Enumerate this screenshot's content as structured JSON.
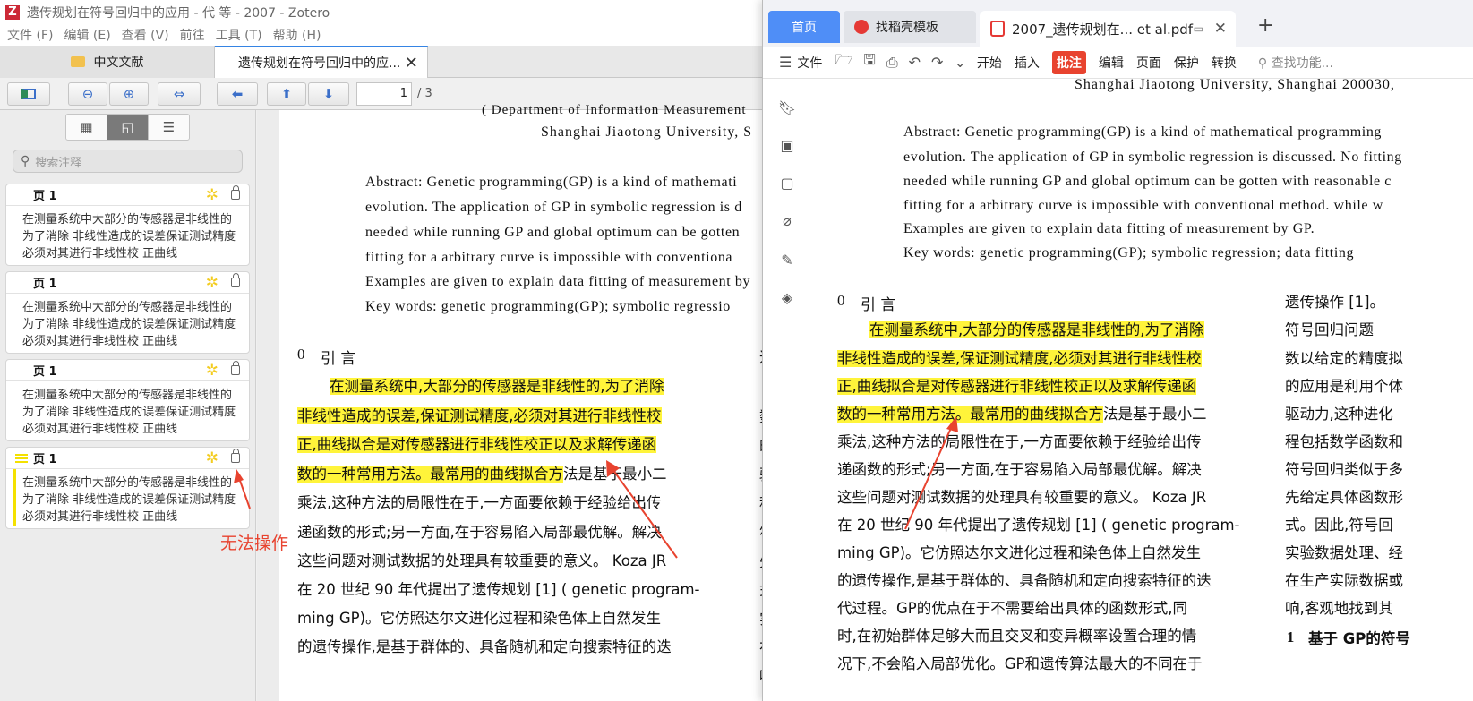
{
  "zotero": {
    "window_title": "遗传规划在符号回归中的应用 - 代 等 - 2007 - Zotero",
    "menu": [
      "文件 (F)",
      "编辑 (E)",
      "查看 (V)",
      "前往",
      "工具 (T)",
      "帮助 (H)"
    ],
    "tabs": [
      {
        "label": "中文文献"
      },
      {
        "label": "遗传规划在符号回归中的应..."
      }
    ],
    "toolbar": {
      "page_value": "1",
      "page_total": "/ 3"
    },
    "sidebar": {
      "search_placeholder": "搜索注释",
      "annotations": [
        {
          "page": "页 1",
          "text": "在测量系统中大部分的传感器是非线性的为了消除 非线性造成的误差保证测试精度必须对其进行非线性校 正曲线"
        },
        {
          "page": "页 1",
          "text": "在测量系统中大部分的传感器是非线性的为了消除 非线性造成的误差保证测试精度必须对其进行非线性校 正曲线"
        },
        {
          "page": "页 1",
          "text": "在测量系统中大部分的传感器是非线性的为了消除 非线性造成的误差保证测试精度必须对其进行非线性校 正曲线"
        },
        {
          "page": "页 1",
          "text": "在测量系统中大部分的传感器是非线性的为了消除 非线性造成的误差保证测试精度必须对其进行非线性校 正曲线"
        }
      ],
      "annotation_note": "无法操作"
    },
    "pdf": {
      "affil1": "( Department of Information Measurement",
      "affil2": "Shanghai Jiaotong University, S",
      "abstract_lines": [
        "Abstract:  Genetic programming(GP) is a kind of mathemati",
        "evolution. The application of GP  in  symbolic  regression  is  d",
        "needed while running GP and global optimum  can be gotten",
        "fitting for a arbitrary curve  is  impossible  with  conventiona",
        "Examples are given to explain data fitting of measurement by",
        "Key words:  genetic programming(GP);  symbolic regressio"
      ],
      "section_num": "0",
      "section_title": "引  言",
      "hl_lines": [
        "在测量系统中,大部分的传感器是非线性的,为了消除",
        "非线性造成的误差,保证测试精度,必须对其进行非线性校",
        "正,曲线拟合是对传感器进行非线性校正以及求解传递函",
        "数的一种常用方法。最常用的曲线拟合方"
      ],
      "hl_tail": "法是基于最小二",
      "body_lines": [
        "乘法,这种方法的局限性在于,一方面要依赖于经验给出传",
        "递函数的形式;另一方面,在于容易陷入局部最优解。解决",
        "这些问题对测试数据的处理具有较重要的意义。 Koza JR",
        "在  20 世纪   90 年代提出了遗传规划 [1] ( genetic program-",
        "ming GP)。它仿照达尔文进化过程和染色体上自然发生",
        "的遗传操作,是基于群体的、具备随机和定向搜索特征的迭"
      ],
      "right_col": [
        "进",
        "数",
        "的",
        "驱",
        "程",
        "符",
        "先",
        "式",
        "实",
        "在",
        "响"
      ]
    }
  },
  "wps": {
    "tabs": {
      "home": "首页",
      "template": "找稻壳模板",
      "pdf": "2007_遗传规划在... et al.pdf"
    },
    "ribbon": [
      "开始",
      "插入",
      "批注",
      "编辑",
      "页面",
      "保护",
      "转换"
    ],
    "file_label": "文件",
    "search_label": "查找功能...",
    "pdf": {
      "affil": "Shanghai Jiaotong University, Shanghai 200030,",
      "abstract_lines": [
        "Abstract:  Genetic programming(GP) is a kind of mathematical programming",
        "evolution. The application of GP  in  symbolic  regression  is  discussed. No  fitting",
        "needed while running GP and global optimum  can be gotten  with  reasonable  c",
        "fitting for a arbitrary curve  is  impossible  with  conventional  method. while  w",
        "Examples are given to explain data fitting of measurement by GP.",
        "Key words:  genetic programming(GP);  symbolic regression;  data fitting"
      ],
      "section_num": "0",
      "section_title": "引  言",
      "hl_lines": [
        "在测量系统中,大部分的传感器是非线性的,为了消除",
        "非线性造成的误差,保证测试精度,必须对其进行非线性校",
        "正,曲线拟合是对传感器进行非线性校正以及求解传递函",
        "数的一种常用方法。最常用的曲线拟合方"
      ],
      "hl_tail": "法是基于最小二",
      "body_lines": [
        "乘法,这种方法的局限性在于,一方面要依赖于经验给出传",
        "递函数的形式;另一方面,在于容易陷入局部最优解。解决",
        "这些问题对测试数据的处理具有较重要的意义。 Koza JR",
        "在  20 世纪   90 年代提出了遗传规划 [1] ( genetic program-",
        "ming GP)。它仿照达尔文进化过程和染色体上自然发生",
        "的遗传操作,是基于群体的、具备随机和定向搜索特征的迭",
        "代过程。GP的优点在于不需要给出具体的函数形式,同",
        "时,在初始群体足够大而且交叉和变异概率设置合理的情",
        "况下,不会陷入局部优化。GP和遗传算法最大的不同在于"
      ],
      "right_col_lines": [
        "遗传操作 [1]。",
        "    符号回归问题",
        "数以给定的精度拟",
        "的应用是利用个体",
        "驱动力,这种进化",
        "程包括数学函数和",
        "符号回归类似于多",
        "先给定具体函数形",
        "式。因此,符号回",
        "实验数据处理、经",
        "在生产实际数据或",
        "响,客观地找到其"
      ],
      "sec1_num": "1",
      "sec1_title": "基于 GP的符号"
    }
  }
}
